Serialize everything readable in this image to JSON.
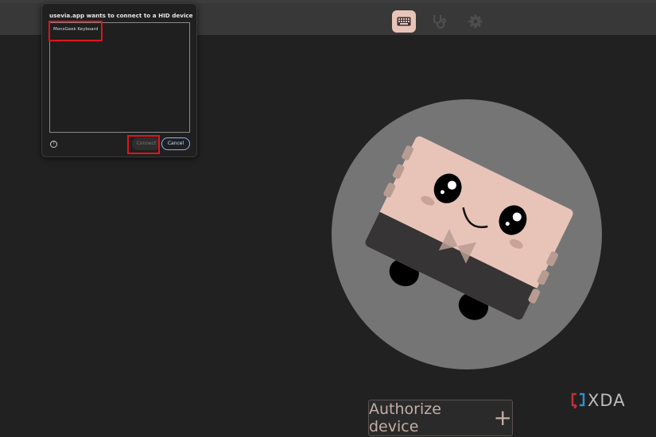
{
  "toolbar": {
    "icons": [
      "keyboard-icon",
      "stethoscope-icon",
      "gear-icon"
    ],
    "active": "keyboard"
  },
  "dialog": {
    "title": "usevia.app wants to connect to a HID device",
    "devices": [
      "MonsGeek Keyboard"
    ],
    "connect_label": "Connect",
    "cancel_label": "Cancel",
    "help_glyph": "?"
  },
  "main": {
    "authorize_label": "Authorize device",
    "authorize_icon": "+"
  },
  "watermark": {
    "text": "XDA"
  },
  "colors": {
    "accent": "#e8c4b8",
    "highlight": "#e0141e",
    "circle": "#757575"
  }
}
